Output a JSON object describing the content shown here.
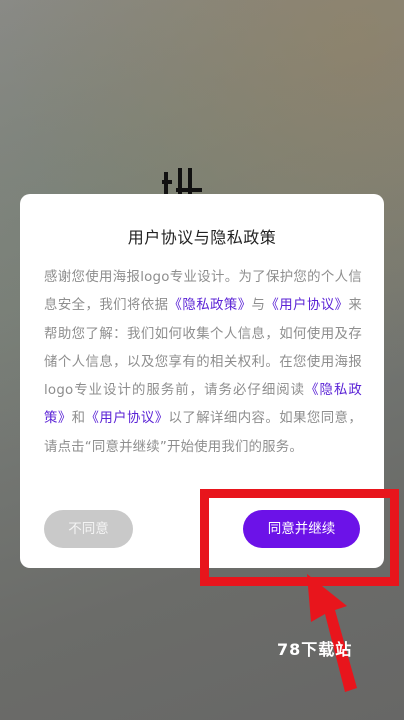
{
  "background": {
    "partial_title_glyph": "让"
  },
  "dialog": {
    "title": "用户协议与隐私政策",
    "body_segments": [
      {
        "text": "感谢您使用海报logo专业设计。为了保护您的个人信息安全，我们将依据",
        "link": false
      },
      {
        "text": "《隐私政策》",
        "link": true
      },
      {
        "text": "与",
        "link": false
      },
      {
        "text": "《用户协议》",
        "link": true
      },
      {
        "text": "来帮助您了解：我们如何收集个人信息，如何使用及存储个人信息，以及您享有的相关权利。在您使用海报logo专业设计的服务前，请务必仔细阅读",
        "link": false
      },
      {
        "text": "《隐私政策》",
        "link": true
      },
      {
        "text": "和",
        "link": false
      },
      {
        "text": "《用户协议》",
        "link": true
      },
      {
        "text": "以了解详细内容。如果您同意，请点击“同意并继续”开始使用我们的服务。",
        "link": false
      }
    ],
    "disagree_label": "不同意",
    "agree_label": "同意并继续"
  },
  "annotation": {
    "highlight_color": "#e8151c",
    "watermark_text": "78下载站"
  },
  "colors": {
    "link": "#5b23d6",
    "agree_button": "#6c12e8",
    "disagree_button": "#c9c9c9"
  }
}
